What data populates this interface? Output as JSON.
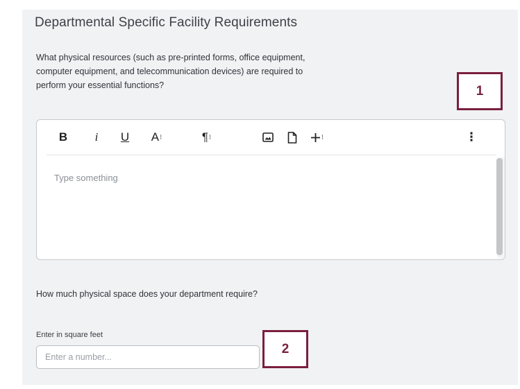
{
  "section": {
    "title": "Departmental Specific Facility Requirements"
  },
  "question1": {
    "label": "What physical resources (such as pre-printed forms, office equipment, computer equipment, and telecommunication devices) are required to perform your essential functions?",
    "placeholder": "Type something"
  },
  "toolbar": {
    "bold": "B",
    "italic": "i",
    "underline": "U",
    "font_size": "A",
    "paragraph": "¶",
    "more": "⋮"
  },
  "question2": {
    "label": "How much physical space does your department require?",
    "helper": "Enter in square feet",
    "placeholder": "Enter a number..."
  },
  "badges": {
    "one": "1",
    "two": "2"
  },
  "colors": {
    "badge": "#7a1f3d",
    "panel_bg": "#f1f2f4"
  }
}
